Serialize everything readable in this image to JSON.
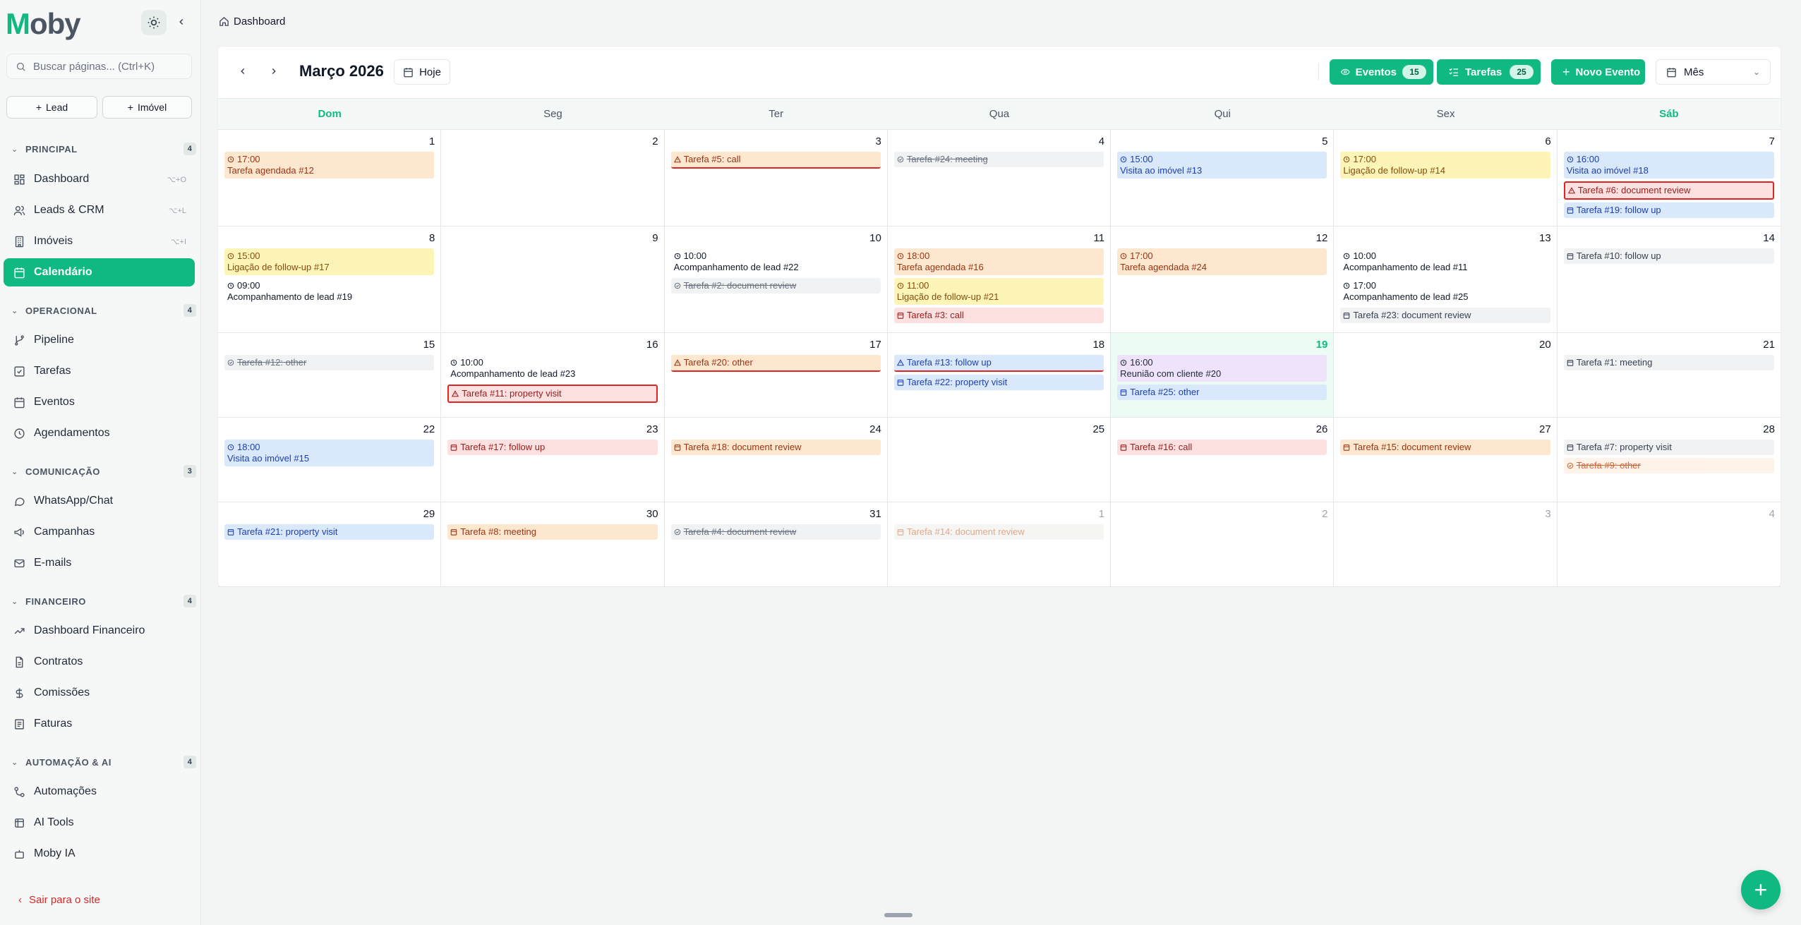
{
  "app": {
    "logo_first": "M",
    "logo_rest": "oby"
  },
  "sidebar": {
    "search_placeholder": "Buscar páginas... (Ctrl+K)",
    "quick_lead": "Lead",
    "quick_imovel": "Imóvel",
    "sections": {
      "principal": {
        "label": "PRINCIPAL",
        "count": "4"
      },
      "operacional": {
        "label": "OPERACIONAL",
        "count": "4"
      },
      "comunicacao": {
        "label": "COMUNICAÇÃO",
        "count": "3"
      },
      "financeiro": {
        "label": "FINANCEIRO",
        "count": "4"
      },
      "automacao": {
        "label": "AUTOMAÇÃO & AI",
        "count": "4"
      }
    },
    "items": {
      "dashboard": {
        "label": "Dashboard",
        "kbd": "⌥+O"
      },
      "leads": {
        "label": "Leads & CRM",
        "kbd": "⌥+L"
      },
      "imoveis": {
        "label": "Imóveis",
        "kbd": "⌥+I"
      },
      "calendario": {
        "label": "Calendário"
      },
      "pipeline": {
        "label": "Pipeline"
      },
      "tarefas": {
        "label": "Tarefas"
      },
      "eventos": {
        "label": "Eventos"
      },
      "agendamentos": {
        "label": "Agendamentos"
      },
      "whatsapp": {
        "label": "WhatsApp/Chat"
      },
      "campanhas": {
        "label": "Campanhas"
      },
      "emails": {
        "label": "E-mails"
      },
      "dash_fin": {
        "label": "Dashboard Financeiro"
      },
      "contratos": {
        "label": "Contratos"
      },
      "comissoes": {
        "label": "Comissões"
      },
      "faturas": {
        "label": "Faturas"
      },
      "automacoes": {
        "label": "Automações"
      },
      "ai_tools": {
        "label": "AI Tools"
      },
      "moby_ia": {
        "label": "Moby IA"
      }
    },
    "logout": "Sair para o site"
  },
  "breadcrumb": "Dashboard",
  "toolbar": {
    "month": "Março 2026",
    "today": "Hoje",
    "eventos_label": "Eventos",
    "eventos_count": "15",
    "tarefas_label": "Tarefas",
    "tarefas_count": "25",
    "novo_evento": "Novo Evento",
    "view": "Mês"
  },
  "weekdays": [
    "Dom",
    "Seg",
    "Ter",
    "Qua",
    "Qui",
    "Sex",
    "Sáb"
  ],
  "weeks": [
    {
      "days": [
        {
          "n": "1",
          "ev": [
            {
              "time": "17:00",
              "title": "Tarefa agendada #12",
              "c": "orange",
              "icon": "clock"
            }
          ]
        },
        {
          "n": "2",
          "ev": []
        },
        {
          "n": "3",
          "ev": [
            {
              "title": "Tarefa #5: call",
              "c": "orange",
              "icon": "warn",
              "od": true
            }
          ]
        },
        {
          "n": "4",
          "ev": [
            {
              "title": "Tarefa #24: meeting",
              "c": "done",
              "icon": "check"
            }
          ]
        },
        {
          "n": "5",
          "ev": [
            {
              "time": "15:00",
              "title": "Visita ao imóvel #13",
              "c": "blue",
              "icon": "clock"
            }
          ]
        },
        {
          "n": "6",
          "ev": [
            {
              "time": "17:00",
              "title": "Ligação de follow-up #14",
              "c": "yellow",
              "icon": "clock"
            }
          ]
        },
        {
          "n": "7",
          "ev": [
            {
              "time": "16:00",
              "title": "Visita ao imóvel #18",
              "c": "blue",
              "icon": "clock"
            },
            {
              "title": "Tarefa #6: document review",
              "c": "red",
              "icon": "warn",
              "box": true
            },
            {
              "title": "Tarefa #19: follow up",
              "c": "blue",
              "icon": "cal"
            }
          ]
        }
      ]
    },
    {
      "days": [
        {
          "n": "8",
          "ev": [
            {
              "time": "15:00",
              "title": "Ligação de follow-up #17",
              "c": "yellow",
              "icon": "clock"
            },
            {
              "time": "09:00",
              "title": "Acompanhamento de lead #19",
              "c": "plain",
              "icon": "clock"
            }
          ]
        },
        {
          "n": "9",
          "ev": []
        },
        {
          "n": "10",
          "ev": [
            {
              "time": "10:00",
              "title": "Acompanhamento de lead #22",
              "c": "plain",
              "icon": "clock"
            },
            {
              "title": "Tarefa #2: document review",
              "c": "done",
              "icon": "check"
            }
          ]
        },
        {
          "n": "11",
          "ev": [
            {
              "time": "18:00",
              "title": "Tarefa agendada #16",
              "c": "orange",
              "icon": "clock"
            },
            {
              "time": "11:00",
              "title": "Ligação de follow-up #21",
              "c": "yellow",
              "icon": "clock"
            },
            {
              "title": "Tarefa #3: call",
              "c": "red",
              "icon": "cal"
            }
          ]
        },
        {
          "n": "12",
          "ev": [
            {
              "time": "17:00",
              "title": "Tarefa agendada #24",
              "c": "orange",
              "icon": "clock"
            }
          ]
        },
        {
          "n": "13",
          "ev": [
            {
              "time": "10:00",
              "title": "Acompanhamento de lead #11",
              "c": "plain",
              "icon": "clock"
            },
            {
              "time": "17:00",
              "title": "Acompanhamento de lead #25",
              "c": "plain",
              "icon": "clock"
            },
            {
              "title": "Tarefa #23: document review",
              "c": "gray",
              "icon": "cal"
            }
          ]
        },
        {
          "n": "14",
          "ev": [
            {
              "title": "Tarefa #10: follow up",
              "c": "gray",
              "icon": "cal"
            }
          ]
        }
      ]
    },
    {
      "days": [
        {
          "n": "15",
          "ev": [
            {
              "title": "Tarefa #12: other",
              "c": "done",
              "icon": "check"
            }
          ]
        },
        {
          "n": "16",
          "ev": [
            {
              "time": "10:00",
              "title": "Acompanhamento de lead #23",
              "c": "plain",
              "icon": "clock"
            },
            {
              "title": "Tarefa #11: property visit",
              "c": "red",
              "icon": "warn",
              "box": true
            }
          ]
        },
        {
          "n": "17",
          "ev": [
            {
              "title": "Tarefa #20: other",
              "c": "orange",
              "icon": "warn",
              "od": true
            }
          ]
        },
        {
          "n": "18",
          "ev": [
            {
              "title": "Tarefa #13: follow up",
              "c": "blue",
              "icon": "warn",
              "od": true
            },
            {
              "title": "Tarefa #22: property visit",
              "c": "blue",
              "icon": "cal"
            }
          ]
        },
        {
          "n": "19",
          "today": true,
          "ev": [
            {
              "time": "16:00",
              "title": "Reunião com cliente #20",
              "c": "purple",
              "icon": "clock"
            },
            {
              "title": "Tarefa #25: other",
              "c": "blue",
              "icon": "cal"
            }
          ]
        },
        {
          "n": "20",
          "ev": []
        },
        {
          "n": "21",
          "ev": [
            {
              "title": "Tarefa #1: meeting",
              "c": "gray",
              "icon": "cal"
            }
          ]
        }
      ]
    },
    {
      "days": [
        {
          "n": "22",
          "ev": [
            {
              "time": "18:00",
              "title": "Visita ao imóvel #15",
              "c": "blue",
              "icon": "clock"
            }
          ]
        },
        {
          "n": "23",
          "ev": [
            {
              "title": "Tarefa #17: follow up",
              "c": "red",
              "icon": "cal"
            }
          ]
        },
        {
          "n": "24",
          "ev": [
            {
              "title": "Tarefa #18: document review",
              "c": "orange",
              "icon": "cal"
            }
          ]
        },
        {
          "n": "25",
          "ev": []
        },
        {
          "n": "26",
          "ev": [
            {
              "title": "Tarefa #16: call",
              "c": "red",
              "icon": "cal"
            }
          ]
        },
        {
          "n": "27",
          "ev": [
            {
              "title": "Tarefa #15: document review",
              "c": "orange",
              "icon": "cal"
            }
          ]
        },
        {
          "n": "28",
          "ev": [
            {
              "title": "Tarefa #7: property visit",
              "c": "gray",
              "icon": "cal"
            },
            {
              "title": "Tarefa #9: other",
              "c": "done-o",
              "icon": "check"
            }
          ]
        }
      ]
    },
    {
      "days": [
        {
          "n": "29",
          "ev": [
            {
              "title": "Tarefa #21: property visit",
              "c": "blue",
              "icon": "cal"
            }
          ]
        },
        {
          "n": "30",
          "ev": [
            {
              "title": "Tarefa #8: meeting",
              "c": "orange",
              "icon": "cal"
            }
          ]
        },
        {
          "n": "31",
          "ev": [
            {
              "title": "Tarefa #4: document review",
              "c": "done",
              "icon": "check"
            }
          ]
        },
        {
          "n": "1",
          "other": true,
          "ev": [
            {
              "title": "Tarefa #14: document review",
              "c": "faded",
              "icon": "cal"
            }
          ]
        },
        {
          "n": "2",
          "other": true,
          "ev": []
        },
        {
          "n": "3",
          "other": true,
          "ev": []
        },
        {
          "n": "4",
          "other": true,
          "ev": []
        }
      ]
    }
  ]
}
